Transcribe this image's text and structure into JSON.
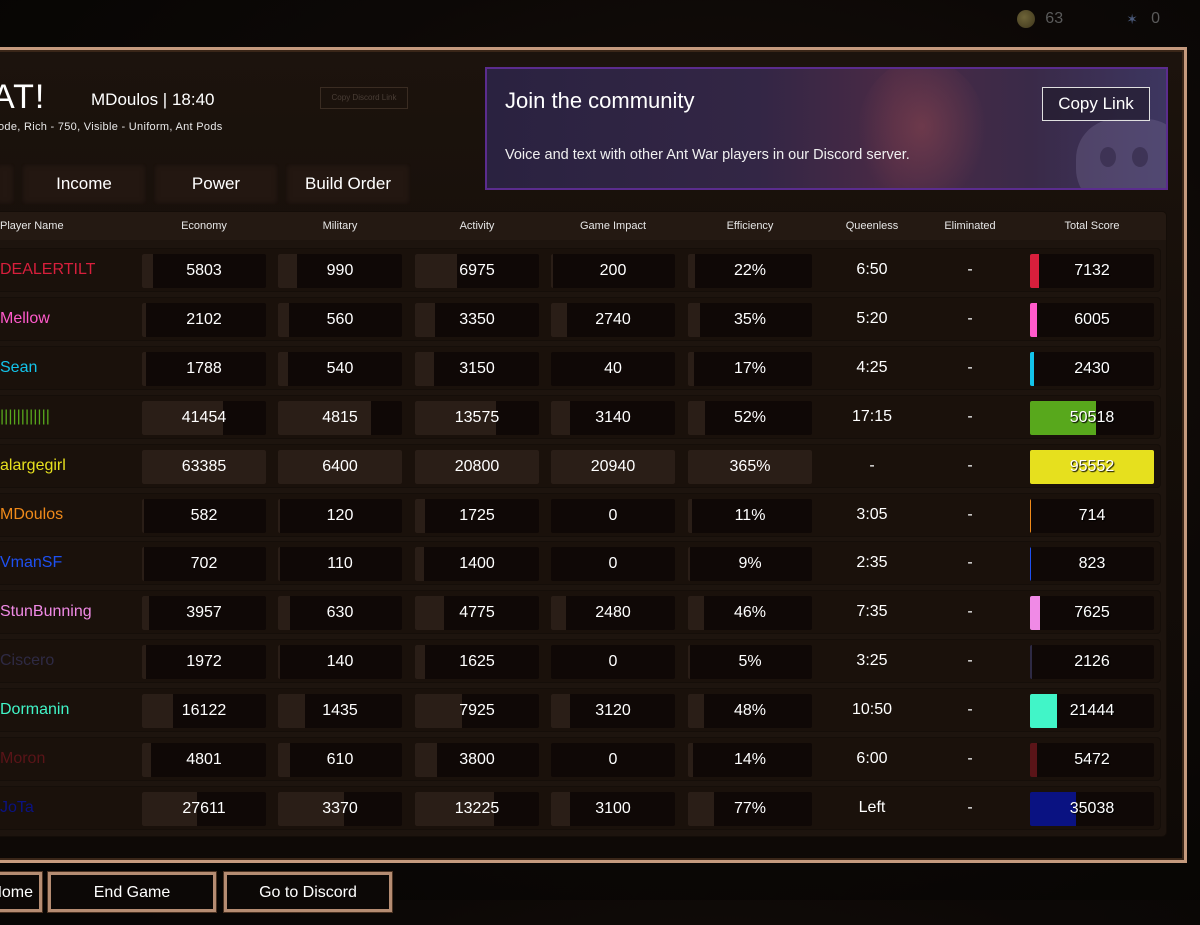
{
  "topbar": {
    "coins": "63",
    "ants": "0",
    "coin_icon": "coin-icon",
    "ant_icon": "ant-icon"
  },
  "header": {
    "title_fragment": "AT!",
    "player_time": "MDoulos | 18:40",
    "settings": "ode, Rich - 750, Visible - Uniform, Ant Pods",
    "copy_discord_small": "Copy Discord Link"
  },
  "tabs": [
    {
      "label": ""
    },
    {
      "label": "Income"
    },
    {
      "label": "Power"
    },
    {
      "label": "Build Order"
    }
  ],
  "community": {
    "title": "Join the community",
    "description": "Voice and text with other Ant War players in our Discord server.",
    "copy_link": "Copy Link"
  },
  "table": {
    "columns": [
      "Player Name",
      "Economy",
      "Military",
      "Activity",
      "Game Impact",
      "Efficiency",
      "Queenless",
      "Eliminated",
      "Total Score"
    ],
    "rows": [
      {
        "name": "DEALERTILT",
        "color": "#d81f3c",
        "economy": "5803",
        "military": "990",
        "activity": "6975",
        "impact": "200",
        "efficiency": "22%",
        "queenless": "6:50",
        "eliminated": "-",
        "score": "7132",
        "fills": {
          "economy": 0.09,
          "military": 0.15,
          "activity": 0.34,
          "impact": 0.01,
          "efficiency": 0.06,
          "score": 0.07
        }
      },
      {
        "name": "Mellow",
        "color": "#ff5acb",
        "economy": "2102",
        "military": "560",
        "activity": "3350",
        "impact": "2740",
        "efficiency": "35%",
        "queenless": "5:20",
        "eliminated": "-",
        "score": "6005",
        "fills": {
          "economy": 0.03,
          "military": 0.09,
          "activity": 0.16,
          "impact": 0.13,
          "efficiency": 0.1,
          "score": 0.06
        }
      },
      {
        "name": "Sean",
        "color": "#13c3ea",
        "economy": "1788",
        "military": "540",
        "activity": "3150",
        "impact": "40",
        "efficiency": "17%",
        "queenless": "4:25",
        "eliminated": "-",
        "score": "2430",
        "fills": {
          "economy": 0.03,
          "military": 0.08,
          "activity": 0.15,
          "impact": 0.0,
          "efficiency": 0.05,
          "score": 0.03
        }
      },
      {
        "name": "||||||||||||",
        "color": "#58a81c",
        "economy": "41454",
        "military": "4815",
        "activity": "13575",
        "impact": "3140",
        "efficiency": "52%",
        "queenless": "17:15",
        "eliminated": "-",
        "score": "50518",
        "fills": {
          "economy": 0.65,
          "military": 0.75,
          "activity": 0.65,
          "impact": 0.15,
          "efficiency": 0.14,
          "score": 0.53
        }
      },
      {
        "name": "alargegirl",
        "color": "#e6e01e",
        "economy": "63385",
        "military": "6400",
        "activity": "20800",
        "impact": "20940",
        "efficiency": "365%",
        "queenless": "-",
        "eliminated": "-",
        "score": "95552",
        "fills": {
          "economy": 1.0,
          "military": 1.0,
          "activity": 1.0,
          "impact": 1.0,
          "efficiency": 1.0,
          "score": 1.0
        }
      },
      {
        "name": "MDoulos",
        "color": "#f08a1a",
        "economy": "582",
        "military": "120",
        "activity": "1725",
        "impact": "0",
        "efficiency": "11%",
        "queenless": "3:05",
        "eliminated": "-",
        "score": "714",
        "fills": {
          "economy": 0.01,
          "military": 0.02,
          "activity": 0.08,
          "impact": 0.0,
          "efficiency": 0.03,
          "score": 0.01
        }
      },
      {
        "name": "VmanSF",
        "color": "#1e50f0",
        "economy": "702",
        "military": "110",
        "activity": "1400",
        "impact": "0",
        "efficiency": "9%",
        "queenless": "2:35",
        "eliminated": "-",
        "score": "823",
        "fills": {
          "economy": 0.01,
          "military": 0.02,
          "activity": 0.07,
          "impact": 0.0,
          "efficiency": 0.02,
          "score": 0.01
        }
      },
      {
        "name": "StunBunning",
        "color": "#f08ae6",
        "economy": "3957",
        "military": "630",
        "activity": "4775",
        "impact": "2480",
        "efficiency": "46%",
        "queenless": "7:35",
        "eliminated": "-",
        "score": "7625",
        "fills": {
          "economy": 0.06,
          "military": 0.1,
          "activity": 0.23,
          "impact": 0.12,
          "efficiency": 0.13,
          "score": 0.08
        }
      },
      {
        "name": "Ciscero",
        "color": "#2e2a44",
        "economy": "1972",
        "military": "140",
        "activity": "1625",
        "impact": "0",
        "efficiency": "5%",
        "queenless": "3:25",
        "eliminated": "-",
        "score": "2126",
        "fills": {
          "economy": 0.03,
          "military": 0.02,
          "activity": 0.08,
          "impact": 0.0,
          "efficiency": 0.01,
          "score": 0.02
        }
      },
      {
        "name": "Dormanin",
        "color": "#41f5c8",
        "economy": "16122",
        "military": "1435",
        "activity": "7925",
        "impact": "3120",
        "efficiency": "48%",
        "queenless": "10:50",
        "eliminated": "-",
        "score": "21444",
        "fills": {
          "economy": 0.25,
          "military": 0.22,
          "activity": 0.38,
          "impact": 0.15,
          "efficiency": 0.13,
          "score": 0.22
        }
      },
      {
        "name": "Moron",
        "color": "#5a1418",
        "economy": "4801",
        "military": "610",
        "activity": "3800",
        "impact": "0",
        "efficiency": "14%",
        "queenless": "6:00",
        "eliminated": "-",
        "score": "5472",
        "fills": {
          "economy": 0.07,
          "military": 0.1,
          "activity": 0.18,
          "impact": 0.0,
          "efficiency": 0.04,
          "score": 0.06
        }
      },
      {
        "name": "JoTa",
        "color": "#0a1282",
        "economy": "27611",
        "military": "3370",
        "activity": "13225",
        "impact": "3100",
        "efficiency": "77%",
        "queenless": "Left",
        "eliminated": "-",
        "score": "35038",
        "fills": {
          "economy": 0.44,
          "military": 0.53,
          "activity": 0.64,
          "impact": 0.15,
          "efficiency": 0.21,
          "score": 0.37
        }
      }
    ]
  },
  "footer": {
    "buttons": [
      {
        "label": "Home"
      },
      {
        "label": "End Game"
      },
      {
        "label": "Go to Discord"
      }
    ]
  }
}
